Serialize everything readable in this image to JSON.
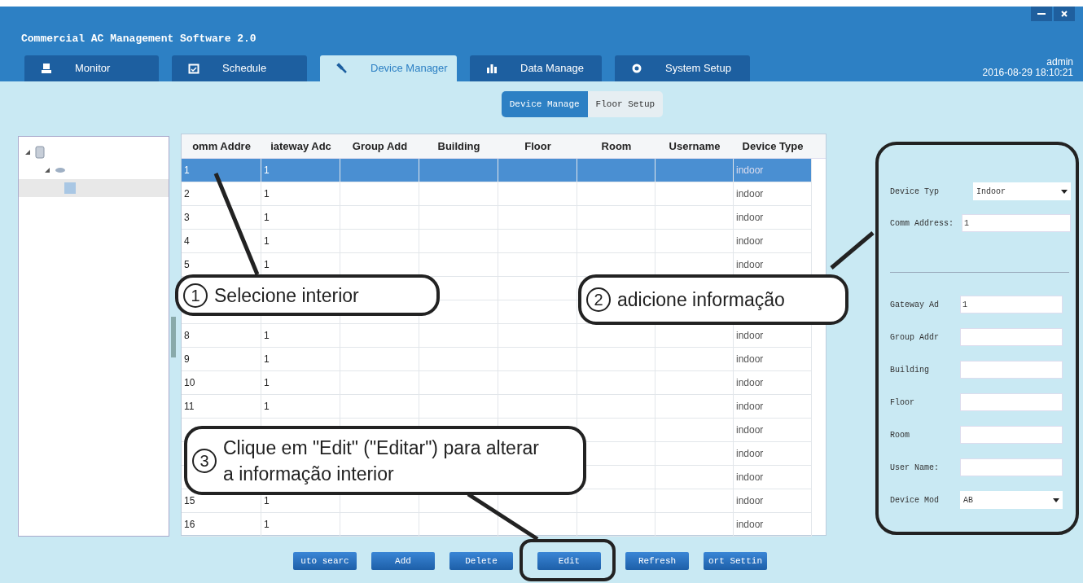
{
  "window": {
    "title": "Commercial AC Management Software 2.0",
    "user": "admin",
    "datetime": "2016-08-29 18:10:21"
  },
  "tabs": [
    {
      "label": "Monitor",
      "selected": false
    },
    {
      "label": "Schedule",
      "selected": false
    },
    {
      "label": "Device Manager",
      "selected": true
    },
    {
      "label": "Data Manage",
      "selected": false
    },
    {
      "label": "System Setup",
      "selected": false
    }
  ],
  "subtabs": [
    {
      "label": "Device Manage",
      "selected": true
    },
    {
      "label": "Floor Setup",
      "selected": false
    }
  ],
  "tree": {
    "items": [
      {
        "expanded": true,
        "selected": false,
        "children": [
          {
            "expanded": true,
            "selected": false,
            "children": [
              {
                "selected": true
              }
            ]
          }
        ]
      }
    ]
  },
  "table": {
    "columns": [
      "omm Addre",
      "iateway Adc",
      "Group Add",
      "Building",
      "Floor",
      "Room",
      "Username",
      "Device Type"
    ],
    "rows": [
      {
        "comm_address": "1",
        "gateway_address": "1",
        "device_type": "indoor",
        "selected": true
      },
      {
        "comm_address": "2",
        "gateway_address": "1",
        "device_type": "indoor",
        "selected": false
      },
      {
        "comm_address": "3",
        "gateway_address": "1",
        "device_type": "indoor",
        "selected": false
      },
      {
        "comm_address": "4",
        "gateway_address": "1",
        "device_type": "indoor",
        "selected": false
      },
      {
        "comm_address": "5",
        "gateway_address": "1",
        "device_type": "indoor",
        "selected": false
      },
      {
        "selected": false
      },
      {
        "selected": false
      },
      {
        "comm_address": "8",
        "gateway_address": "1",
        "device_type": "indoor",
        "selected": false
      },
      {
        "comm_address": "9",
        "gateway_address": "1",
        "device_type": "indoor",
        "selected": false
      },
      {
        "comm_address": "10",
        "gateway_address": "1",
        "device_type": "indoor",
        "selected": false
      },
      {
        "comm_address": "11",
        "gateway_address": "1",
        "device_type": "indoor",
        "selected": false
      },
      {
        "device_type": "indoor",
        "selected": false
      },
      {
        "device_type": "indoor",
        "selected": false
      },
      {
        "device_type": "indoor",
        "selected": false
      },
      {
        "comm_address": "15",
        "gateway_address": "1",
        "device_type": "indoor",
        "selected": false
      },
      {
        "comm_address": "16",
        "gateway_address": "1",
        "device_type": "indoor",
        "selected": false
      }
    ]
  },
  "form": {
    "top_fields": [
      {
        "kind": "select",
        "label": "Device Typ",
        "value": "Indoor"
      },
      {
        "kind": "input",
        "label": "Comm Address:",
        "value": "1"
      }
    ],
    "bottom_fields": [
      {
        "kind": "input",
        "label": "Gateway Ad",
        "value": "1"
      },
      {
        "kind": "input",
        "label": "Group Addr"
      },
      {
        "kind": "input",
        "label": "Building"
      },
      {
        "kind": "input",
        "label": "Floor"
      },
      {
        "kind": "input",
        "label": "Room"
      },
      {
        "kind": "input",
        "label": "User Name:"
      },
      {
        "kind": "select",
        "label": "Device Mod",
        "value": "AB"
      }
    ]
  },
  "buttons": [
    "uto searc",
    "Add",
    "Delete",
    "Edit",
    "Refresh",
    "ort Settin"
  ],
  "callouts": [
    {
      "number": "1",
      "text": "Selecione interior"
    },
    {
      "number": "2",
      "text": "adicione informação"
    },
    {
      "number": "3",
      "text": "Clique em \"Edit\" (\"Editar\") para alterar a informação interior"
    }
  ]
}
